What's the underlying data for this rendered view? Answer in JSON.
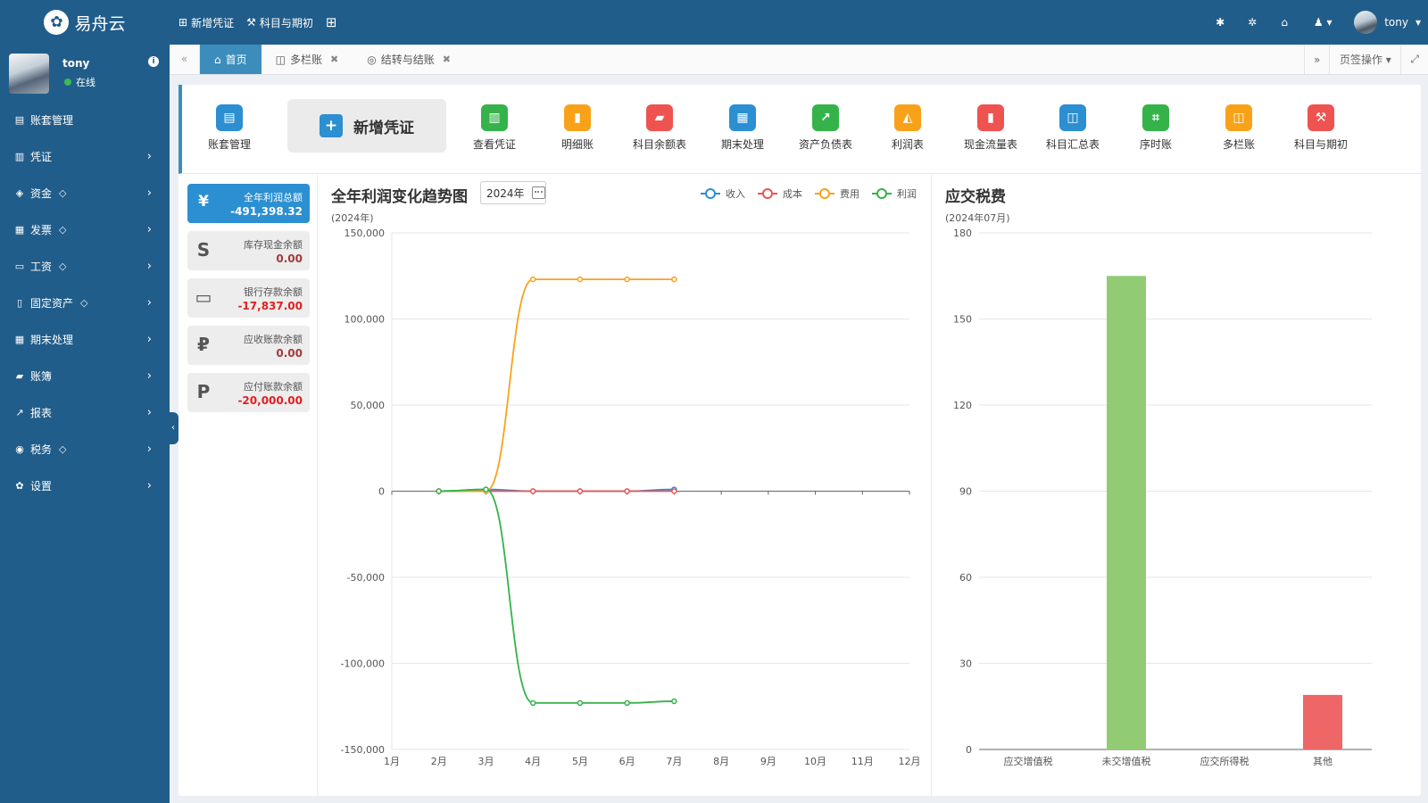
{
  "app": {
    "logo_glyph": "✿",
    "logo_text": "易舟云"
  },
  "topnav": [
    {
      "icon": "⊞",
      "label": "新增凭证"
    },
    {
      "icon": "⚒",
      "label": "科目与期初"
    },
    {
      "icon": "⊞",
      "label": ""
    }
  ],
  "topright": {
    "username": "tony",
    "user_glyph": "♟ ▾",
    "caret": "▾"
  },
  "sidebar": {
    "username": "tony",
    "status": "在线",
    "info_glyph": "i",
    "items": [
      {
        "icon": "▤",
        "label": "账套管理",
        "gem": "",
        "caret": ""
      },
      {
        "icon": "▥",
        "label": "凭证",
        "gem": "",
        "caret": "›"
      },
      {
        "icon": "◈",
        "label": "资金",
        "gem": "◇",
        "caret": "›"
      },
      {
        "icon": "▦",
        "label": "发票",
        "gem": "◇",
        "caret": "›"
      },
      {
        "icon": "▭",
        "label": "工资",
        "gem": "◇",
        "caret": "›"
      },
      {
        "icon": "▯",
        "label": "固定资产",
        "gem": "◇",
        "caret": "›"
      },
      {
        "icon": "▦",
        "label": "期末处理",
        "gem": "",
        "caret": "›"
      },
      {
        "icon": "▰",
        "label": "账簿",
        "gem": "",
        "caret": "›"
      },
      {
        "icon": "↗",
        "label": "报表",
        "gem": "",
        "caret": "›"
      },
      {
        "icon": "◉",
        "label": "税务",
        "gem": "◇",
        "caret": "›"
      },
      {
        "icon": "✿",
        "label": "设置",
        "gem": "",
        "caret": "›"
      }
    ],
    "collapse_glyph": "‹"
  },
  "tabs": {
    "left_glyph": "«",
    "right_glyph": "»",
    "items": [
      {
        "icon": "⌂",
        "label": "首页",
        "close": ""
      },
      {
        "icon": "◫",
        "label": "多栏账",
        "close": "✖"
      },
      {
        "icon": "◎",
        "label": "结转与结账",
        "close": "✖"
      }
    ],
    "actions_label": "页签操作 ▾",
    "fullscreen_glyph": "⤢"
  },
  "quick_actions": {
    "big_button": {
      "icon": "+",
      "label": "新增凭证",
      "color": "#2b8fd1"
    },
    "items": [
      {
        "label": "账套管理",
        "icon": "▤",
        "color": "#2b8fd1"
      },
      {
        "label": "查看凭证",
        "icon": "▥",
        "color": "#35b34a"
      },
      {
        "label": "明细账",
        "icon": "▮",
        "color": "#f8a21a"
      },
      {
        "label": "科目余额表",
        "icon": "▰",
        "color": "#ef5350"
      },
      {
        "label": "期末处理",
        "icon": "▦",
        "color": "#2b8fd1"
      },
      {
        "label": "资产负债表",
        "icon": "↗",
        "color": "#35b34a"
      },
      {
        "label": "利润表",
        "icon": "◭",
        "color": "#f8a21a"
      },
      {
        "label": "现金流量表",
        "icon": "▮",
        "color": "#ef5350"
      },
      {
        "label": "科目汇总表",
        "icon": "◫",
        "color": "#2b8fd1"
      },
      {
        "label": "序时账",
        "icon": "⌗",
        "color": "#35b34a"
      },
      {
        "label": "多栏账",
        "icon": "◫",
        "color": "#f8a21a"
      },
      {
        "label": "科目与期初",
        "icon": "⚒",
        "color": "#ef5350"
      }
    ]
  },
  "stats": [
    {
      "icon": "¥",
      "label": "全年利润总额",
      "value": "-491,398.32",
      "primary": true,
      "value_color": "#ffffff"
    },
    {
      "icon": "S",
      "label": "库存现金余额",
      "value": "0.00",
      "primary": false,
      "value_color": "#a33a3a"
    },
    {
      "icon": "▭",
      "label": "银行存款余额",
      "value": "-17,837.00",
      "primary": false,
      "value_color": "#e02020"
    },
    {
      "icon": "₽",
      "label": "应收账款余额",
      "value": "0.00",
      "primary": false,
      "value_color": "#a33a3a"
    },
    {
      "icon": "P",
      "label": "应付账款余额",
      "value": "-20,000.00",
      "primary": false,
      "value_color": "#e02020"
    }
  ],
  "profit_chart": {
    "title": "全年利润变化趋势图",
    "year": "2024年",
    "subtitle": "(2024年)"
  },
  "tax_chart": {
    "title": "应交税费",
    "subtitle": "(2024年07月)"
  },
  "chart_data": [
    {
      "type": "line",
      "title": "全年利润变化趋势图",
      "subtitle": "(2024年)",
      "categories": [
        "1月",
        "2月",
        "3月",
        "4月",
        "5月",
        "6月",
        "7月",
        "8月",
        "9月",
        "10月",
        "11月",
        "12月"
      ],
      "ylim": [
        -150000,
        150000
      ],
      "yticks": [
        150000,
        100000,
        50000,
        0,
        -50000,
        -100000,
        -150000
      ],
      "ytick_labels": [
        "150,000",
        "100,000",
        "50,000",
        "0",
        "-50,000",
        "-100,000",
        "-150,000"
      ],
      "grid": true,
      "legend": "top-right",
      "series": [
        {
          "name": "收入",
          "color": "#2b8fd1",
          "values": [
            null,
            0,
            1000,
            0,
            0,
            0,
            1000
          ]
        },
        {
          "name": "成本",
          "color": "#ef5350",
          "values": [
            null,
            0,
            0,
            0,
            0,
            0,
            0
          ]
        },
        {
          "name": "费用",
          "color": "#f8a21a",
          "values": [
            null,
            0,
            0,
            123000,
            123000,
            123000,
            123000
          ]
        },
        {
          "name": "利润",
          "color": "#35b34a",
          "values": [
            null,
            0,
            1000,
            -123000,
            -123000,
            -123000,
            -122000
          ]
        }
      ]
    },
    {
      "type": "bar",
      "title": "应交税费",
      "subtitle": "(2024年07月)",
      "categories": [
        "应交增值税",
        "未交增值税",
        "应交所得税",
        "其他"
      ],
      "values": [
        0,
        165,
        0,
        19
      ],
      "colors": [
        "#91cc75",
        "#91cc75",
        "#91cc75",
        "#ee6666"
      ],
      "ylim": [
        0,
        180
      ],
      "yticks": [
        0,
        30,
        60,
        90,
        120,
        150,
        180
      ],
      "grid": true
    }
  ]
}
